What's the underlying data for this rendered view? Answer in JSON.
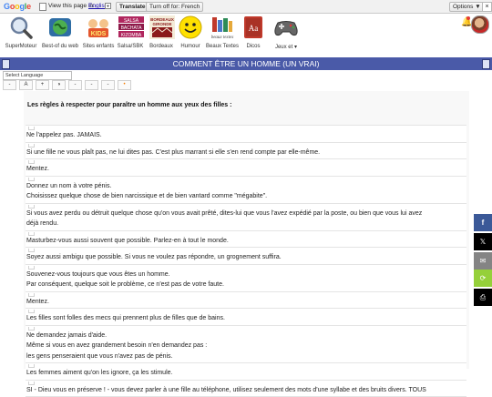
{
  "translate_bar": {
    "logo": "Google",
    "view_prefix": "View this page in:",
    "language": "English",
    "translate_button": "Translate",
    "turn_off_button": "Turn off for: French",
    "options_button": "Options ▼",
    "close": "×"
  },
  "nav": {
    "items": [
      {
        "label": "SuperMoteur",
        "icon": "magnifier-icon",
        "color": "#8aa0c8"
      },
      {
        "label": "Best-of du web",
        "icon": "globe-icon",
        "color": "#3f8f4a"
      },
      {
        "label": "Sites enfants",
        "icon": "kids-icon",
        "color": "#e4572e"
      },
      {
        "label": "Salsa/SBK",
        "icon": "salsa-icon",
        "color": "#b0265e",
        "text": "SALSA BACHATA KIZOMBA"
      },
      {
        "label": "Bordeaux",
        "icon": "bordeaux-icon",
        "color": "#8b1a1a",
        "text": "BORDEAUX GIRONDE"
      },
      {
        "label": "Humour",
        "icon": "smiley-icon",
        "color": "#ffe000"
      },
      {
        "label": "Beaux Textes",
        "icon": "books-icon",
        "color": "#4a78c8",
        "text": "beaux textes"
      },
      {
        "label": "Dicos",
        "icon": "dictionary-icon",
        "color": "#c0392b",
        "text": "Aa"
      },
      {
        "label": "Jeux et",
        "icon": "gamepad-icon",
        "color": "#555555"
      }
    ]
  },
  "title": "COMMENT ÊTRE UN HOMME (UN VRAI)",
  "language_select": "Select Language",
  "tools": [
    "-",
    "A",
    "+",
    "◑",
    "-",
    "-",
    "-",
    "•"
  ],
  "intro": "Les règles à respecter pour paraître un homme aux yeux des filles :",
  "items": [
    [
      "Ne l'appelez pas. JAMAIS."
    ],
    [
      "Si une fille ne vous plaît pas, ne lui dites pas. C'est plus marrant si elle s'en rend compte par elle-même."
    ],
    [
      "Mentez."
    ],
    [
      "Donnez un nom à votre pénis.",
      "Choisissez quelque chose de bien narcissique et de bien vantard comme \"mégabite\"."
    ],
    [
      "Si vous avez perdu ou détruit quelque chose qu'on vous avait prêté, dites-lui que vous l'avez expédié par la poste, ou bien que vous lui avez",
      "déjà rendu."
    ],
    [
      "Masturbez-vous aussi souvent que possible. Parlez-en à tout le monde."
    ],
    [
      "Soyez aussi ambigu que possible. Si vous ne voulez pas répondre, un grognement suffira."
    ],
    [
      "Souvenez-vous toujours que vous êtes un homme.",
      "Par conséquent, quelque soit le problème, ce n'est pas de votre faute."
    ],
    [
      "Mentez."
    ],
    [
      "Les filles sont folles des mecs qui prennent plus de filles que de bains."
    ],
    [
      "Ne demandez jamais d'aide.",
      "Même si vous en avez grandement besoin n'en demandez pas :",
      "les gens penseraient que vous n'avez pas de pénis."
    ],
    [
      "Les femmes aiment qu'on les ignore, ça les stimule."
    ],
    [
      "SI - Dieu vous en préserve ! - vous devez parler à une fille au téléphone, utilisez seulement des mots d'une syllabe et des bruits divers. TOUS"
    ]
  ],
  "share": {
    "facebook": "f",
    "x": "𝕏",
    "email": "✉",
    "share": "⟳",
    "print": "⎙"
  }
}
